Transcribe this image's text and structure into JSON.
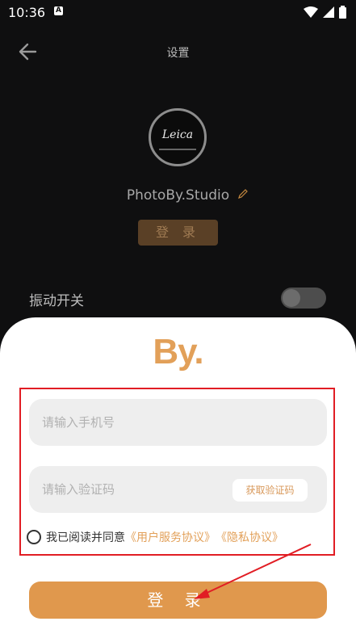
{
  "status_bar": {
    "time": "10:36",
    "notif_badge": "A"
  },
  "header": {
    "title": "设置"
  },
  "profile": {
    "avatar_text": "Leica",
    "name": "PhotoBy.Studio",
    "login_label": "登 录"
  },
  "settings": {
    "vibration_label": "振动开关",
    "vibration_on": false
  },
  "sheet": {
    "logo": "By.",
    "phone_placeholder": "请输入手机号",
    "code_placeholder": "请输入验证码",
    "get_code_label": "获取验证码",
    "agree_text": "我已阅读并同意",
    "terms_link": "《用户服务协议》",
    "privacy_link": "《隐私协议》",
    "login_label": "登 录"
  },
  "colors": {
    "accent": "#e0984d",
    "annotation": "#e11d24"
  }
}
